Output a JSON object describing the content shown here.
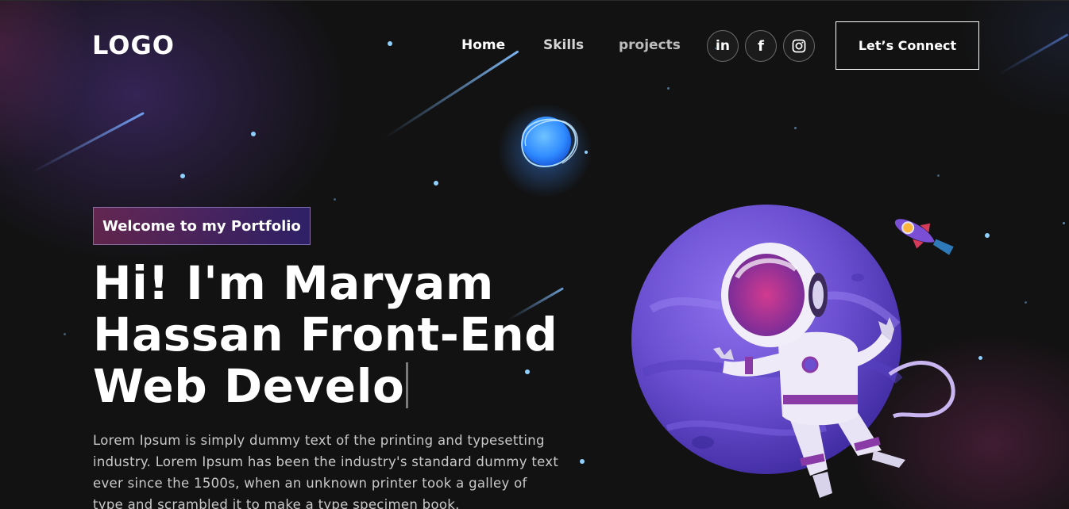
{
  "brand": {
    "logo": "LOGO"
  },
  "nav": {
    "links": [
      {
        "label": "Home",
        "active": true
      },
      {
        "label": "Skills",
        "active": false
      },
      {
        "label": "projects",
        "active": false
      }
    ],
    "social": [
      {
        "icon": "linkedin-icon",
        "glyph": "in"
      },
      {
        "icon": "facebook-icon",
        "glyph": "f"
      },
      {
        "icon": "instagram-icon",
        "glyph": ""
      }
    ],
    "cta_label": "Let’s Connect"
  },
  "hero": {
    "tagline": "Welcome to my Portfolio",
    "headline_lines": [
      "Hi! I'm Maryam",
      "Hassan Front-End",
      "Web Develo"
    ],
    "bio_lines": [
      "Lorem Ipsum is simply dummy text of the printing and typesetting",
      "industry. Lorem Ipsum has been the industry's standard dummy text",
      "ever since the 1500s, when an unknown printer took a galley of",
      "type and scrambled it to make a type specimen book."
    ]
  },
  "colors": {
    "background": "#121212",
    "accent_pink": "#aa367c",
    "accent_purple": "#4a2fbd",
    "star_blue": "#8fd0ff",
    "planet_purple": "#6a4fd0"
  },
  "illustration": {
    "items": [
      "blue-planet-icon",
      "purple-planet-icon",
      "astronaut-icon",
      "rocket-icon"
    ]
  }
}
